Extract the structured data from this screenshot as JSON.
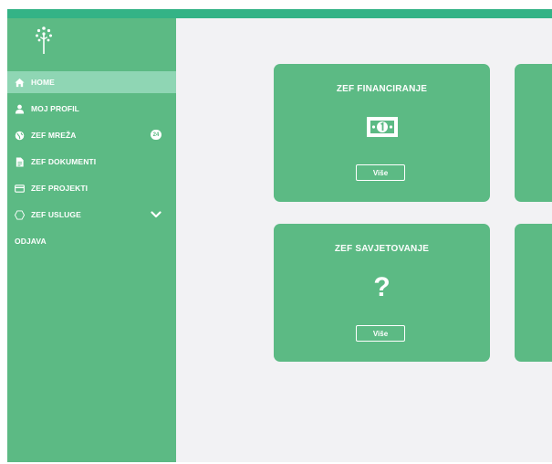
{
  "brand": {
    "logo_icon": "tree-icon",
    "accent": "#5cba84",
    "top_bar": "#34b386",
    "active_bg": "#8fd6b4"
  },
  "sidebar": {
    "items": [
      {
        "label": "HOME",
        "icon": "home-icon",
        "active": true
      },
      {
        "label": "MOJ PROFIL",
        "icon": "user-icon"
      },
      {
        "label": "ZEF MREŽA",
        "icon": "globe-icon",
        "badge": "24"
      },
      {
        "label": "ZEF DOKUMENTI",
        "icon": "document-icon"
      },
      {
        "label": "ZEF PROJEKTI",
        "icon": "card-icon"
      },
      {
        "label": "ZEF USLUGE",
        "icon": "hexagon-icon",
        "expand_icon": "chevron-down-icon"
      }
    ],
    "logout_label": "ODJAVA"
  },
  "cards": [
    {
      "title": "ZEF FINANCIRANJE",
      "icon": "banknote-icon",
      "button_label": "Više"
    },
    {
      "title": "ZEF SAVJETOVANJE",
      "icon": "question-icon",
      "icon_text": "?",
      "button_label": "Više"
    }
  ]
}
